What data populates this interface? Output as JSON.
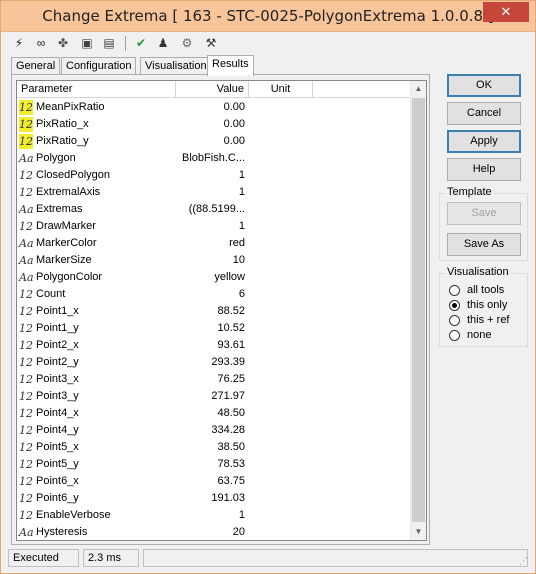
{
  "window": {
    "title": "Change Extrema [ 163 - STC-0025-PolygonExtrema 1.0.0.8 ]",
    "close_label": "✕"
  },
  "toolbar": {
    "icons": [
      {
        "name": "lightning-icon",
        "glyph": "⚡",
        "color": "#222222"
      },
      {
        "name": "link-icon",
        "glyph": "∞",
        "color": "#222222"
      },
      {
        "name": "puzzle-icon",
        "glyph": "✤",
        "color": "#555555"
      },
      {
        "name": "console-icon",
        "glyph": "▣",
        "color": "#444444"
      },
      {
        "name": "document-icon",
        "glyph": "▤",
        "color": "#444444"
      },
      {
        "name": "checkmark-icon",
        "glyph": "✔",
        "color": "#1e9a3a"
      },
      {
        "name": "pawn-icon",
        "glyph": "♟",
        "color": "#333333"
      },
      {
        "name": "network-icon",
        "glyph": "⚙",
        "color": "#6a6a6a"
      },
      {
        "name": "wrench-icon",
        "glyph": "⚒",
        "color": "#333333"
      }
    ]
  },
  "tabs": [
    {
      "label": "General",
      "active": false
    },
    {
      "label": "Configuration",
      "active": false
    },
    {
      "label": "Visualisation",
      "active": false
    },
    {
      "label": "Results",
      "active": true
    }
  ],
  "grid": {
    "columns": {
      "parameter": "Parameter",
      "value": "Value",
      "unit": "Unit"
    },
    "rows": [
      {
        "type": "12",
        "highlight": true,
        "name": "MeanPixRatio",
        "value": "0.00",
        "unit": ""
      },
      {
        "type": "12",
        "highlight": true,
        "name": "PixRatio_x",
        "value": "0.00",
        "unit": ""
      },
      {
        "type": "12",
        "highlight": true,
        "name": "PixRatio_y",
        "value": "0.00",
        "unit": ""
      },
      {
        "type": "Aa",
        "highlight": false,
        "name": "Polygon",
        "value": "BlobFish.C...",
        "unit": ""
      },
      {
        "type": "12",
        "highlight": false,
        "name": "ClosedPolygon",
        "value": "1",
        "unit": ""
      },
      {
        "type": "12",
        "highlight": false,
        "name": "ExtremalAxis",
        "value": "1",
        "unit": ""
      },
      {
        "type": "Aa",
        "highlight": false,
        "name": "Extremas",
        "value": "((88.5199...",
        "unit": ""
      },
      {
        "type": "12",
        "highlight": false,
        "name": "DrawMarker",
        "value": "1",
        "unit": ""
      },
      {
        "type": "Aa",
        "highlight": false,
        "name": "MarkerColor",
        "value": "red",
        "unit": ""
      },
      {
        "type": "Aa",
        "highlight": false,
        "name": "MarkerSize",
        "value": "10",
        "unit": ""
      },
      {
        "type": "Aa",
        "highlight": false,
        "name": "PolygonColor",
        "value": "yellow",
        "unit": ""
      },
      {
        "type": "12",
        "highlight": false,
        "name": "Count",
        "value": "6",
        "unit": ""
      },
      {
        "type": "12",
        "highlight": false,
        "name": "Point1_x",
        "value": "88.52",
        "unit": ""
      },
      {
        "type": "12",
        "highlight": false,
        "name": "Point1_y",
        "value": "10.52",
        "unit": ""
      },
      {
        "type": "12",
        "highlight": false,
        "name": "Point2_x",
        "value": "93.61",
        "unit": ""
      },
      {
        "type": "12",
        "highlight": false,
        "name": "Point2_y",
        "value": "293.39",
        "unit": ""
      },
      {
        "type": "12",
        "highlight": false,
        "name": "Point3_x",
        "value": "76.25",
        "unit": ""
      },
      {
        "type": "12",
        "highlight": false,
        "name": "Point3_y",
        "value": "271.97",
        "unit": ""
      },
      {
        "type": "12",
        "highlight": false,
        "name": "Point4_x",
        "value": "48.50",
        "unit": ""
      },
      {
        "type": "12",
        "highlight": false,
        "name": "Point4_y",
        "value": "334.28",
        "unit": ""
      },
      {
        "type": "12",
        "highlight": false,
        "name": "Point5_x",
        "value": "38.50",
        "unit": ""
      },
      {
        "type": "12",
        "highlight": false,
        "name": "Point5_y",
        "value": "78.53",
        "unit": ""
      },
      {
        "type": "12",
        "highlight": false,
        "name": "Point6_x",
        "value": "63.75",
        "unit": ""
      },
      {
        "type": "12",
        "highlight": false,
        "name": "Point6_y",
        "value": "191.03",
        "unit": ""
      },
      {
        "type": "12",
        "highlight": false,
        "name": "EnableVerbose",
        "value": "1",
        "unit": ""
      },
      {
        "type": "Aa",
        "highlight": false,
        "name": "Hysteresis",
        "value": "20",
        "unit": ""
      }
    ],
    "scroll_up": "▲",
    "scroll_down": "▼"
  },
  "buttons": {
    "ok": "OK",
    "cancel": "Cancel",
    "apply": "Apply",
    "help": "Help"
  },
  "template": {
    "title": "Template",
    "save": "Save",
    "save_as": "Save As"
  },
  "visualisation": {
    "title": "Visualisation",
    "options": [
      {
        "label": "all tools",
        "selected": false
      },
      {
        "label": "this only",
        "selected": true
      },
      {
        "label": "this + ref",
        "selected": false
      },
      {
        "label": "none",
        "selected": false
      }
    ]
  },
  "status": {
    "state": "Executed",
    "time": "2.3 ms",
    "grip": "⋰"
  },
  "colors": {
    "highlight": "#f2ee2e",
    "titlebar": "#f8c49a",
    "close": "#c7463b"
  }
}
